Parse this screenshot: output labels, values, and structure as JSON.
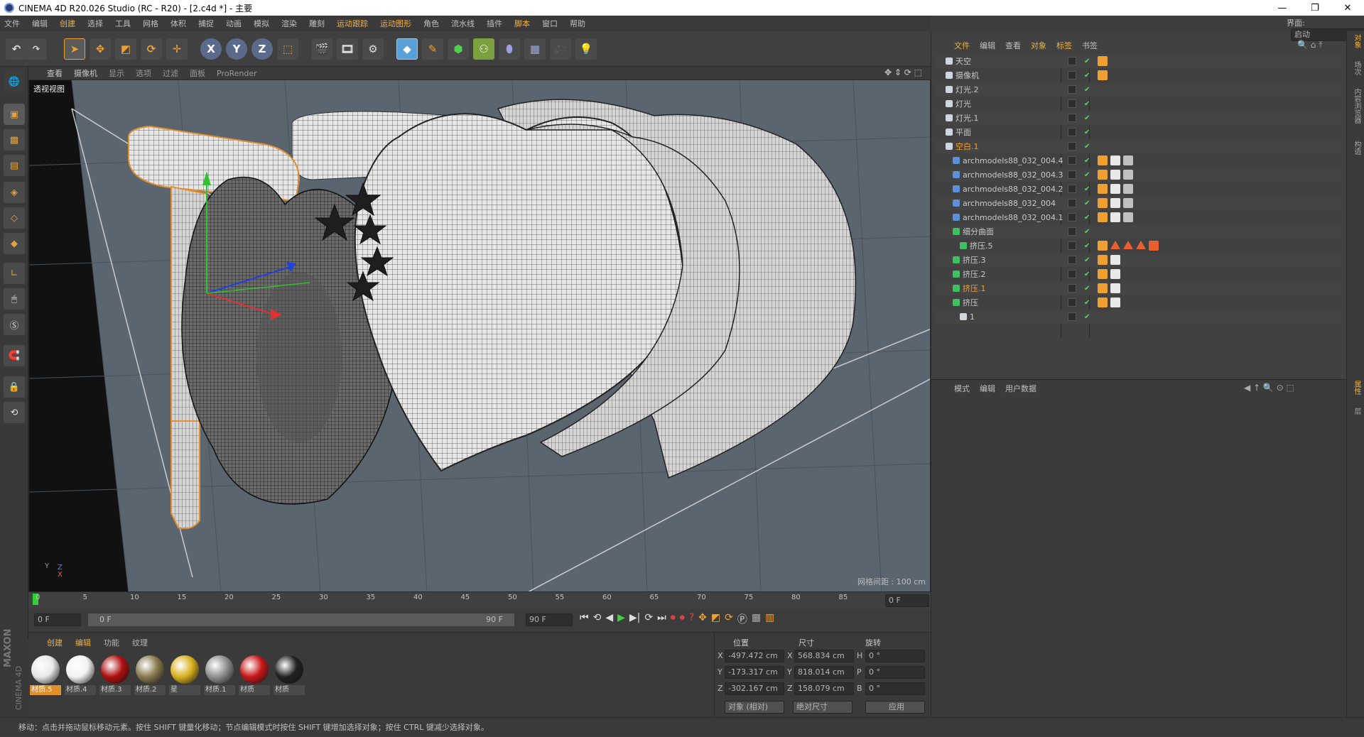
{
  "window": {
    "title": "CINEMA 4D R20.026 Studio (RC - R20) - [2.c4d *] - 主要",
    "layout_label": "界面:",
    "layout_value": "启动"
  },
  "menu": [
    "文件",
    "编辑",
    "创建",
    "选择",
    "工具",
    "网格",
    "体积",
    "捕捉",
    "动画",
    "模拟",
    "渲染",
    "雕刻",
    "运动跟踪",
    "运动图形",
    "角色",
    "流水线",
    "插件",
    "脚本",
    "窗口",
    "帮助"
  ],
  "viewport": {
    "menu": [
      "查看",
      "摄像机",
      "显示",
      "选项",
      "过滤",
      "面板",
      "ProRender"
    ],
    "label": "透视视图",
    "grid_info": "网格间距 : 100 cm",
    "axis_y": "Y",
    "axis_z": "Z",
    "axis_x": "X"
  },
  "timeline": {
    "ticks": [
      "0",
      "5",
      "10",
      "15",
      "20",
      "25",
      "30",
      "35",
      "40",
      "45",
      "50",
      "55",
      "60",
      "65",
      "70",
      "75",
      "80",
      "85",
      "90"
    ],
    "current_frame": "0 F",
    "start_frame": "0 F",
    "range_start": "0 F",
    "range_end": "90 F",
    "end_frame": "90 F"
  },
  "materials": {
    "tabs": [
      "创建",
      "编辑",
      "功能",
      "纹理"
    ],
    "items": [
      {
        "label": "材质.5",
        "color": "#e8e8e8",
        "selected": true
      },
      {
        "label": "材质.4",
        "color": "#f2f2f2",
        "selected": false
      },
      {
        "label": "材质.3",
        "color": "#b01010",
        "selected": false
      },
      {
        "label": "材质.2",
        "color": "#8a7a50",
        "selected": false
      },
      {
        "label": "星",
        "color": "#d8b020",
        "selected": false
      },
      {
        "label": "材质.1",
        "color": "#909090",
        "selected": false
      },
      {
        "label": "材质",
        "color": "#c81818",
        "selected": false
      },
      {
        "label": "材质",
        "color": "#222222",
        "selected": false
      }
    ]
  },
  "coords": {
    "headers": [
      "位置",
      "尺寸",
      "旋转"
    ],
    "rows": [
      {
        "axis": "X",
        "pos": "-497.472 cm",
        "size_axis": "X",
        "size": "568.834 cm",
        "rot_axis": "H",
        "rot": "0 °"
      },
      {
        "axis": "Y",
        "pos": "-173.317 cm",
        "size_axis": "Y",
        "size": "818.014 cm",
        "rot_axis": "P",
        "rot": "0 °"
      },
      {
        "axis": "Z",
        "pos": "-302.167 cm",
        "size_axis": "Z",
        "size": "158.079 cm",
        "rot_axis": "B",
        "rot": "0 °"
      }
    ],
    "mode": "对象 (相对)",
    "size_mode": "绝对尺寸",
    "apply": "应用"
  },
  "objects": {
    "menu": [
      "文件",
      "编辑",
      "查看",
      "对象",
      "标签",
      "书签"
    ],
    "rows": [
      {
        "name": "天空",
        "indent": 0,
        "orange": false
      },
      {
        "name": "摄像机",
        "indent": 0,
        "orange": false
      },
      {
        "name": "灯光.2",
        "indent": 0,
        "orange": false
      },
      {
        "name": "灯光",
        "indent": 0,
        "orange": false
      },
      {
        "name": "灯光.1",
        "indent": 0,
        "orange": false
      },
      {
        "name": "平面",
        "indent": 0,
        "orange": false
      },
      {
        "name": "空白.1",
        "indent": 0,
        "orange": true
      },
      {
        "name": "archmodels88_032_004.4",
        "indent": 1,
        "orange": false
      },
      {
        "name": "archmodels88_032_004.3",
        "indent": 1,
        "orange": false
      },
      {
        "name": "archmodels88_032_004.2",
        "indent": 1,
        "orange": false
      },
      {
        "name": "archmodels88_032_004",
        "indent": 1,
        "orange": false
      },
      {
        "name": "archmodels88_032_004.1",
        "indent": 1,
        "orange": false
      },
      {
        "name": "细分曲面",
        "indent": 1,
        "orange": false
      },
      {
        "name": "挤压.5",
        "indent": 2,
        "orange": false
      },
      {
        "name": "挤压.3",
        "indent": 1,
        "orange": false
      },
      {
        "name": "挤压.2",
        "indent": 1,
        "orange": false
      },
      {
        "name": "挤压.1",
        "indent": 1,
        "orange": true
      },
      {
        "name": "挤压",
        "indent": 1,
        "orange": false
      },
      {
        "name": "1",
        "indent": 2,
        "orange": false
      }
    ]
  },
  "attributes": {
    "menu": [
      "模式",
      "编辑",
      "用户数据"
    ]
  },
  "side_tabs": [
    "对象",
    "场次",
    "内容浏览器",
    "构造"
  ],
  "side_tabs2": [
    "属性",
    "层"
  ],
  "status": "移动：点击并拖动鼠标移动元素。按住 SHIFT 键量化移动；节点编辑模式时按住 SHIFT 键增加选择对象；按住 CTRL 键减少选择对象。",
  "logo_lines": [
    "MAXON",
    "CINEMA 4D"
  ]
}
